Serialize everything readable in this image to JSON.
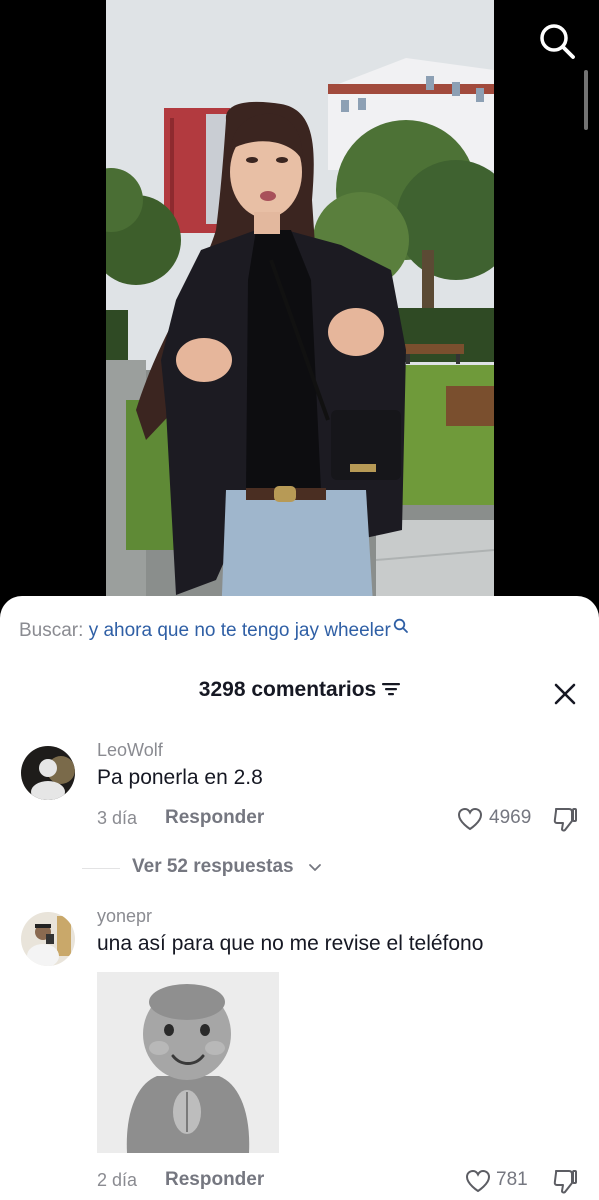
{
  "search": {
    "prefix": "Buscar:",
    "query": "y ahora que no te tengo jay wheeler"
  },
  "comments_header": {
    "count_label": "3298 comentarios"
  },
  "comments": [
    {
      "username": "LeoWolf",
      "text": "Pa ponerla en 2.8",
      "time": "3 día",
      "reply_label": "Responder",
      "likes": "4969",
      "view_replies_label": "Ver 52 respuestas"
    },
    {
      "username": "yonepr",
      "text": "una así para que no me revise el teléfono",
      "time": "2 día",
      "reply_label": "Responder",
      "likes": "781"
    }
  ],
  "icons": {
    "search": "search-icon",
    "filter": "filter-icon",
    "close": "close-icon",
    "like": "heart-icon",
    "dislike": "thumbs-down-icon",
    "chevron": "chevron-down-icon"
  },
  "colors": {
    "query_link": "#2f5fa5",
    "muted_text": "#8a8b91",
    "primary_text": "#161823",
    "sheet_bg": "#ffffff"
  }
}
